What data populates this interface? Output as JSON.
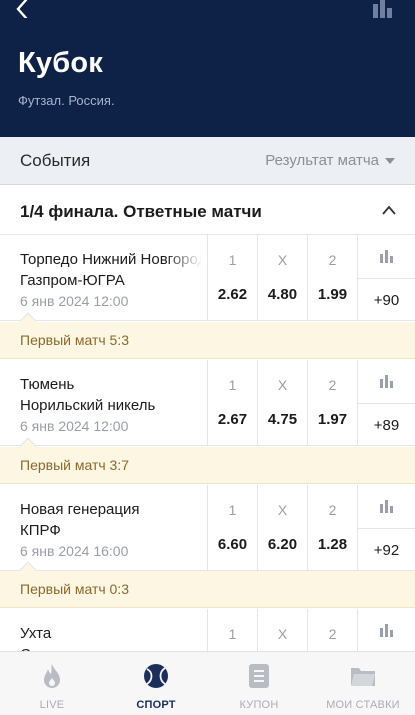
{
  "header": {
    "title": "Кубок",
    "subtitle": "Футзал. Россия."
  },
  "events_bar": {
    "label": "События",
    "market_select": "Результат матча"
  },
  "group": {
    "title": "1/4 финала. Ответные матчи"
  },
  "matches": [
    {
      "team1": "Торпедо Нижний Новгород",
      "team2": "Газпром-ЮГРА",
      "date": "6 янв 2024 12:00",
      "labels": [
        "1",
        "X",
        "2"
      ],
      "odds": [
        "2.62",
        "4.80",
        "1.99"
      ],
      "more": "+90",
      "note": "Первый матч 5:3"
    },
    {
      "team1": "Тюмень",
      "team2": "Норильский никель",
      "date": "6 янв 2024 12:00",
      "labels": [
        "1",
        "X",
        "2"
      ],
      "odds": [
        "2.67",
        "4.75",
        "1.97"
      ],
      "more": "+89",
      "note": "Первый матч 3:7"
    },
    {
      "team1": "Новая генерация",
      "team2": "КПРФ",
      "date": "6 янв 2024 16:00",
      "labels": [
        "1",
        "X",
        "2"
      ],
      "odds": [
        "6.60",
        "6.20",
        "1.28"
      ],
      "more": "+92",
      "note": "Первый матч 0:3"
    },
    {
      "team1": "Ухта",
      "team2": "Синара",
      "labels": [
        "1",
        "X",
        "2"
      ]
    }
  ],
  "tabbar": {
    "tabs": [
      {
        "label": "LIVE",
        "icon": "flame-icon"
      },
      {
        "label": "СПОРТ",
        "icon": "ball-icon"
      },
      {
        "label": "КУПОН",
        "icon": "coupon-icon"
      },
      {
        "label": "МОИ СТАВКИ",
        "icon": "folder-icon"
      }
    ]
  },
  "colors": {
    "header_bg": "#0e2147",
    "note_bg": "#fcf6e2",
    "note_text": "#8a6a2a",
    "active_tab": "#1b2f5c"
  }
}
